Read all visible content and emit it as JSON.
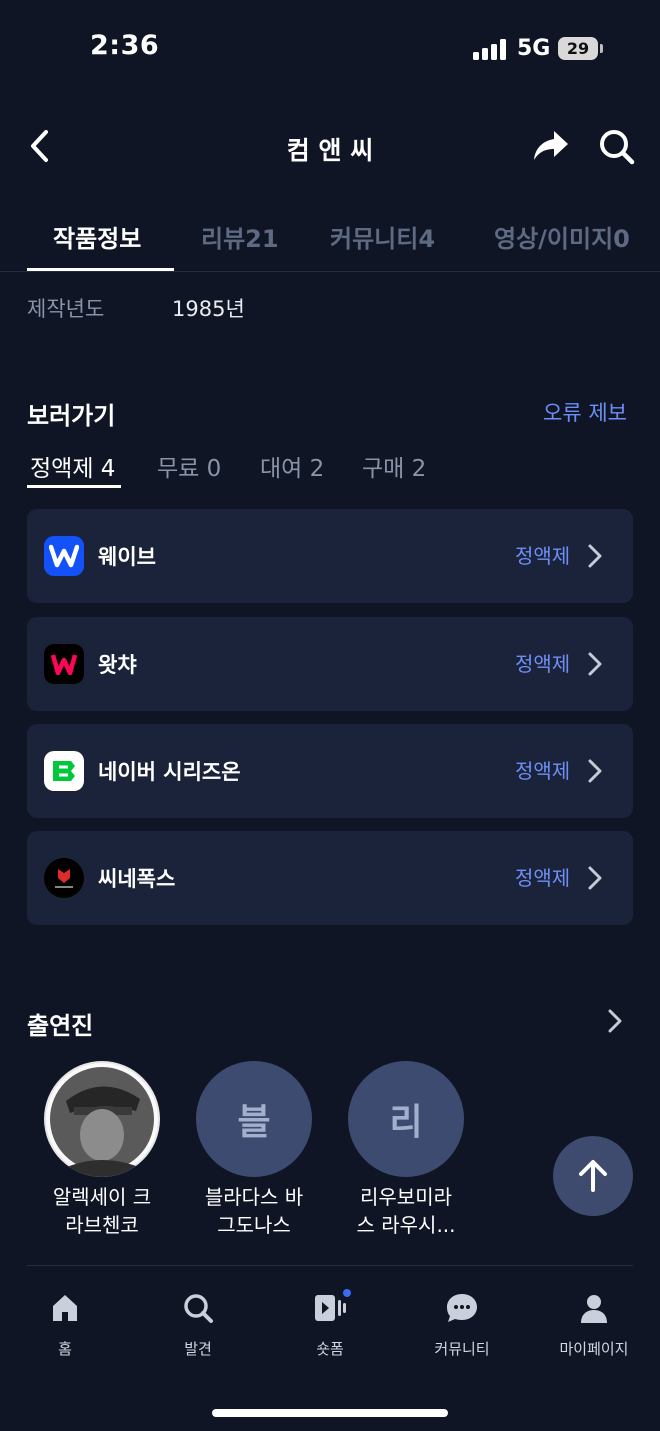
{
  "status_bar": {
    "time": "2:36",
    "network": "5G",
    "battery": "29"
  },
  "header": {
    "title": "컴 앤 씨"
  },
  "tabs": [
    {
      "label": "작품정보",
      "active": true
    },
    {
      "label": "리뷰21",
      "active": false
    },
    {
      "label": "커뮤니티4",
      "active": false
    },
    {
      "label": "영상/이미지0",
      "active": false
    }
  ],
  "info": {
    "year_label": "제작년도",
    "year_value": "1985년"
  },
  "watch": {
    "title": "보러가기",
    "report_link": "오류 제보",
    "subtabs": [
      {
        "label": "정액제 4",
        "active": true
      },
      {
        "label": "무료 0",
        "active": false
      },
      {
        "label": "대여 2",
        "active": false
      },
      {
        "label": "구매 2",
        "active": false
      }
    ],
    "providers": [
      {
        "name": "웨이브",
        "plan": "정액제",
        "logo": "wavve-logo",
        "color": "#1351f9"
      },
      {
        "name": "왓챠",
        "plan": "정액제",
        "logo": "watcha-logo",
        "color": "#ff0558"
      },
      {
        "name": "네이버 시리즈온",
        "plan": "정액제",
        "logo": "naver-serieson-logo",
        "color": "#00c73c"
      },
      {
        "name": "씨네폭스",
        "plan": "정액제",
        "logo": "cinefox-logo",
        "color": "#e02b2b"
      }
    ]
  },
  "cast": {
    "title": "출연진",
    "members": [
      {
        "name_line1": "알렉세이 크",
        "name_line2": "라브첸코",
        "avatar": "photo"
      },
      {
        "name_line1": "블라다스 바",
        "name_line2": "그도나스",
        "avatar": "블"
      },
      {
        "name_line1": "리우보미라",
        "name_line2": "스 라우시...",
        "avatar": "리"
      }
    ]
  },
  "bottom_nav": [
    {
      "label": "홈",
      "icon": "home-icon"
    },
    {
      "label": "발견",
      "icon": "search-icon"
    },
    {
      "label": "숏폼",
      "icon": "shortform-icon",
      "badge": true
    },
    {
      "label": "커뮤니티",
      "icon": "chat-bubble-icon"
    },
    {
      "label": "마이페이지",
      "icon": "person-icon"
    }
  ],
  "colors": {
    "background": "#0f1524",
    "card": "#1b233a",
    "accent": "#6d8ff5",
    "avatar_placeholder": "#3d4b70"
  }
}
